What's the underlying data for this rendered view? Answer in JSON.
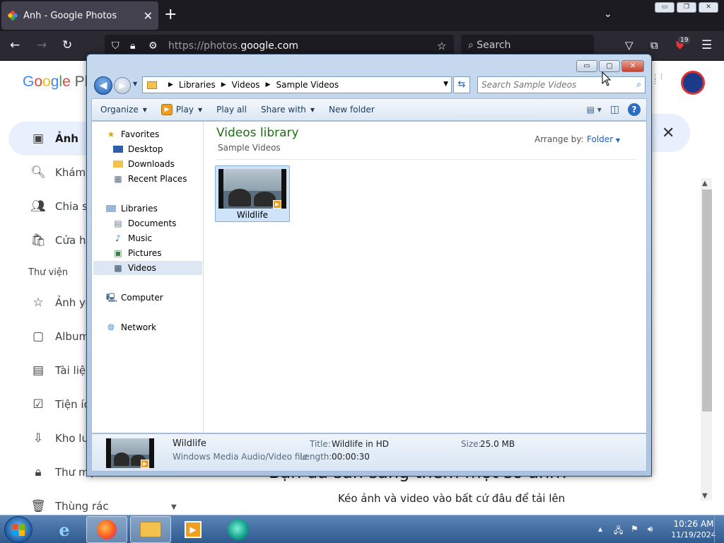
{
  "browser": {
    "tab_title": "Ảnh - Google Photos",
    "tab_close": "✕",
    "new_tab": "+",
    "list_tabs": "⌄",
    "url_host": "https://photos.google.com",
    "url_dim": "https://photos.",
    "url_bright": "google.com",
    "search_placeholder": "Search",
    "extension_badge": "19",
    "window_buttons": [
      "▭",
      "❐",
      "✕"
    ]
  },
  "google_photos": {
    "logo": {
      "G": "G",
      "o1": "o",
      "o2": "o",
      "g": "g",
      "l": "l",
      "e": "e",
      "rest": " Ph"
    },
    "nav": [
      {
        "icon": "photo-icon",
        "glyph": "▣",
        "label": "Ảnh"
      },
      {
        "icon": "search-icon",
        "glyph": "🔍︎",
        "label": "Khám p"
      },
      {
        "icon": "people-icon",
        "glyph": "👥︎",
        "label": "Chia sẻ"
      },
      {
        "icon": "shop-icon",
        "glyph": "🛍︎",
        "label": "Cửa hà"
      }
    ],
    "section": "Thư viện",
    "library": [
      {
        "icon": "star-icon",
        "glyph": "☆",
        "label": "Ảnh yê"
      },
      {
        "icon": "album-icon",
        "glyph": "▢",
        "label": "Album"
      },
      {
        "icon": "document-icon",
        "glyph": "▤",
        "label": "Tài liệu"
      },
      {
        "icon": "utilities-icon",
        "glyph": "☑",
        "label": "Tiện íc"
      },
      {
        "icon": "archive-icon",
        "glyph": "⇩",
        "label": "Kho lưu"
      },
      {
        "icon": "lock-icon",
        "glyph": "🔒︎",
        "label": "Thư mụ"
      },
      {
        "icon": "trash-icon",
        "glyph": "🗑︎",
        "label": "Thùng rác"
      }
    ],
    "banner_close": "✕",
    "apps_glyph": "⋮⋮⋮",
    "upload_heading": "Bạn đã sẵn sàng thêm một số ảnh?",
    "upload_hint": "Kéo ảnh và video vào bất cứ đâu để tải lên"
  },
  "explorer": {
    "window_buttons": [
      "▭",
      "▢",
      "✕"
    ],
    "address": [
      "Libraries",
      "Videos",
      "Sample Videos"
    ],
    "search_placeholder": "Search Sample Videos",
    "toolbar": {
      "organize": "Organize",
      "play": "Play",
      "play_all": "Play all",
      "share_with": "Share with",
      "new_folder": "New folder"
    },
    "nav": {
      "favorites": "Favorites",
      "favorite_items": [
        "Desktop",
        "Downloads",
        "Recent Places"
      ],
      "libraries": "Libraries",
      "library_items": [
        "Documents",
        "Music",
        "Pictures",
        "Videos"
      ],
      "computer": "Computer",
      "network": "Network"
    },
    "library_title": "Videos library",
    "library_subtitle": "Sample Videos",
    "arrange_label": "Arrange by:",
    "arrange_value": "Folder",
    "file": {
      "name": "Wildlife"
    },
    "details": {
      "name": "Wildlife",
      "type": "Windows Media Audio/Video file",
      "title_label": "Title:",
      "title_value": "Wildlife in HD",
      "length_label": "Length:",
      "length_value": "00:00:30",
      "size_label": "Size:",
      "size_value": "25.0 MB"
    }
  },
  "taskbar": {
    "time": "10:26 AM",
    "date": "11/19/2024",
    "tray_arrow": "▴"
  },
  "colors": {
    "explorer_frame": "#a9c3e1",
    "library_title": "#1e6f16",
    "selected_item": "#cfe3fb",
    "browser_dark": "#1c1b22"
  }
}
